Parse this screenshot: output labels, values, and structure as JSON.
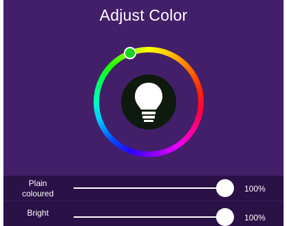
{
  "header": {
    "title": "Adjust Color"
  },
  "color_wheel": {
    "icon": "lightbulb-icon",
    "handle_color": "#19d31f"
  },
  "controls": [
    {
      "label_line1": "Plain",
      "label_line2": "coloured",
      "value": "100%",
      "fraction": 1.0
    },
    {
      "label_line1": "Bright",
      "label_line2": "",
      "value": "100%",
      "fraction": 1.0
    }
  ]
}
